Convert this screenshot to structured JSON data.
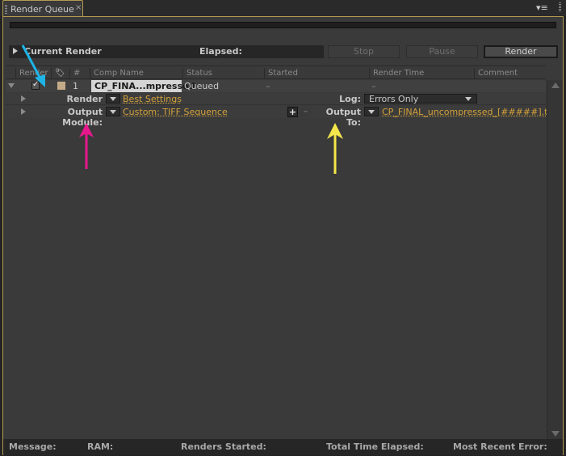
{
  "tab": {
    "title": "Render Queue",
    "close": "×"
  },
  "panel_menu_icon": "▾≡",
  "current_render": {
    "label": "Current Render",
    "elapsed_label": "Elapsed:"
  },
  "buttons": {
    "stop": "Stop",
    "pause": "Pause",
    "render": "Render"
  },
  "columns": [
    "Render",
    "",
    "#",
    "Comp Name",
    "Status",
    "Started",
    "Render Time",
    "Comment"
  ],
  "queue": [
    {
      "checked": true,
      "label_color": "#c4ab88",
      "number": "1",
      "comp_name": "CP_FINA...mpressed",
      "status": "Queued",
      "started": "–",
      "render_time": "–",
      "render_settings_label": "Render Settings:",
      "render_settings_value": "Best Settings",
      "log_label": "Log:",
      "log_value": "Errors Only",
      "output_module_label": "Output Module:",
      "output_module_value": "Custom: TIFF Sequence",
      "output_to_label": "Output To:",
      "output_to_value": "CP_FINAL_uncompressed_[#####].tif",
      "plus": "+",
      "minus": "–"
    }
  ],
  "statusbar": {
    "message": "Message:",
    "ram": "RAM:",
    "renders_started": "Renders Started:",
    "total_time_elapsed": "Total Time Elapsed:",
    "most_recent_error": "Most Recent Error:"
  },
  "annotations": {
    "arrow_cyan": "#1eb4e6",
    "arrow_magenta": "#e6198c",
    "arrow_yellow": "#f5e64b"
  }
}
